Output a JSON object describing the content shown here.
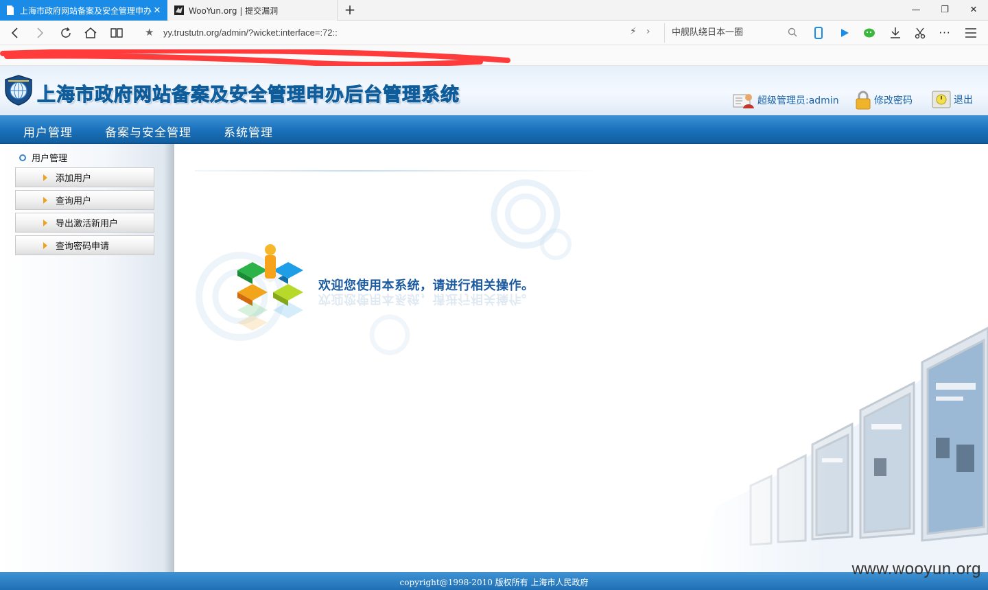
{
  "browser": {
    "tabs": [
      {
        "title": "上海市政府网站备案及安全管理申办",
        "active": true
      },
      {
        "title": "WooYun.org | 提交漏洞",
        "active": false
      }
    ],
    "url": "yy.trustutn.org/admin/?wicket:interface=:72::",
    "search_text": "中舰队绕日本一圈",
    "icons": [
      "back-icon",
      "forward-icon",
      "refresh-icon",
      "home-icon",
      "reading-view-icon",
      "favorite-star-icon",
      "flash-icon",
      "phone-icon",
      "play-icon",
      "wechat-icon",
      "download-icon",
      "scissors-icon",
      "more-icon",
      "menu-icon"
    ]
  },
  "header": {
    "title": "上海市政府网站备案及安全管理申办后台管理系统",
    "user_label": "超级管理员:admin",
    "change_password": "修改密码",
    "logout": "退出"
  },
  "nav": {
    "items": [
      "用户管理",
      "备案与安全管理",
      "系统管理"
    ]
  },
  "sidebar": {
    "section": "用户管理",
    "items": [
      "添加用户",
      "查询用户",
      "导出激活新用户",
      "查询密码申请"
    ]
  },
  "main": {
    "welcome": "欢迎您使用本系统，请进行相关操作。"
  },
  "footer": {
    "copyright": "copyright@1998-2010 版权所有 上海市人民政府",
    "watermark": "www.wooyun.org"
  },
  "colors": {
    "browser_tab_active": "#1a8ce8",
    "nav_bar": "#1c73bd",
    "title_blue": "#2a86cf",
    "link_blue": "#1b63a8",
    "welcome_text": "#1c5aa0",
    "redaction": "#ff3b3b"
  }
}
